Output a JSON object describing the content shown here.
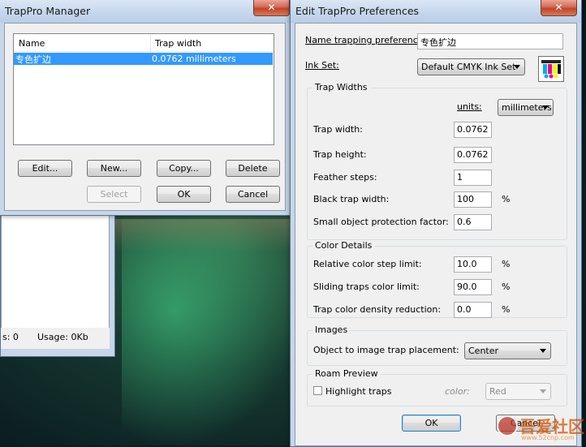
{
  "manager": {
    "title": "TrapPro Manager",
    "list_header_name": "Name",
    "list_header_width": "Trap width",
    "row_name": "专色扩边",
    "row_width": "0.0762 millimeters",
    "edit_label": "Edit...",
    "new_label": "New...",
    "copy_label": "Copy...",
    "delete_label": "Delete",
    "select_label": "Select",
    "ok_label": "OK",
    "cancel_label": "Cancel"
  },
  "behind": {
    "count_text": "s:  0",
    "usage_text": "Usage: 0Kb"
  },
  "prefs": {
    "title": "Edit TrapPro Preferences",
    "name_label": "Name trapping preferences:",
    "name_value": "专色扩边",
    "inkset_label": "Ink Set:",
    "inkset_value": "Default CMYK Ink Set",
    "trap_widths": {
      "group": "Trap Widths",
      "units_label": "units:",
      "units_value": "millimeters",
      "trap_width_label": "Trap width:",
      "trap_width_value": "0.0762",
      "trap_height_label": "Trap height:",
      "trap_height_value": "0.0762",
      "feather_label": "Feather steps:",
      "feather_value": "1",
      "black_label": "Black trap width:",
      "black_value": "100",
      "small_label": "Small object protection factor:",
      "small_value": "0.6",
      "pct": "%"
    },
    "color_details": {
      "group": "Color Details",
      "relative_label": "Relative color step limit:",
      "relative_value": "10.0",
      "sliding_label": "Sliding traps color limit:",
      "sliding_value": "90.0",
      "density_label": "Trap color density reduction:",
      "density_value": "0.0",
      "pct": "%"
    },
    "images": {
      "group": "Images",
      "placement_label": "Object to image trap placement:",
      "placement_value": "Center"
    },
    "roam": {
      "group": "Roam Preview",
      "highlight_label": "Highlight traps",
      "color_label": "color:",
      "color_value": "Red"
    },
    "ok_label": "OK",
    "cancel_label": "Cancel"
  },
  "watermark": "吾爱社区",
  "watermark_url": "www.52cnp.com",
  "colors": {
    "selection": "#3399ff",
    "close": "#c1442c"
  }
}
